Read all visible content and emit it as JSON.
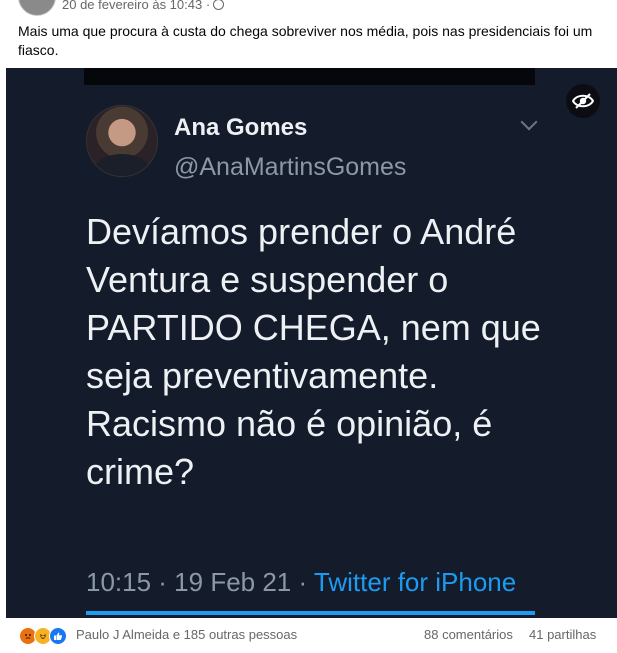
{
  "post": {
    "timestamp": "20 de fevereiro às 10:43 ·",
    "text": "Mais uma que procura à custa do chega sobreviver nos média, pois nas presidenciais foi um fiasco."
  },
  "tweet": {
    "name": "Ana Gomes",
    "handle": "@AnaMartinsGomes",
    "body": "Devíamos prender o André Ventura e suspender o PARTIDO CHEGA, nem que seja preventivamente. Racismo não é opinião, é crime?",
    "time": "10:15 · 19 Feb 21 · ",
    "source": "Twitter for iPhone"
  },
  "footer": {
    "reactions_text": "Paulo J Almeida e 185 outras pessoas",
    "comments": "88 comentários",
    "shares": "41 partilhas"
  },
  "icons": [
    "globe-icon",
    "visibility-icon",
    "chevron-down-icon",
    "angry-reaction-icon",
    "haha-reaction-icon",
    "like-reaction-icon"
  ]
}
